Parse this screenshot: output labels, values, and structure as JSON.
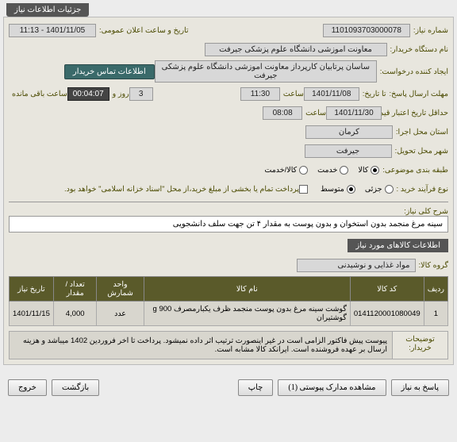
{
  "header_tab": "جزئیات اطلاعات نیاز",
  "labels": {
    "need_no": "شماره نیاز:",
    "buyer": "نام دستگاه خریدار:",
    "creator": "ایجاد کننده درخواست:",
    "deadline": "مهلت ارسال پاسخ:",
    "to_date": "تا تاریخ:",
    "credit_date": "حداقل تاریخ اعتبار قیمت؛ تا تاریخ:",
    "exec_province": "استان محل اجرا:",
    "delivery_city": "شهر محل تحویل:",
    "subject_class": "طبقه بندی موضوعی:",
    "buy_type": "نوع فرآیند خرید :",
    "announce": "تاریخ و ساعت اعلان عمومی:",
    "days_and": "روز و",
    "time_left": "ساعت باقی مانده",
    "hour": "ساعت",
    "contact_btn": "اطلاعات تماس خریدار",
    "main_desc": "شرح کلی نیاز:",
    "goods_info": "اطلاعات کالاهای مورد نیاز",
    "goods_group": "گروه کالا:",
    "buyer_notes": "توضیحات خریدار:"
  },
  "values": {
    "need_no": "1101093703000078",
    "buyer": "معاونت اموزشی دانشگاه علوم پزشکی جیرفت",
    "creator": "ساسان پرتابیان کارپرداز معاونت اموزشی دانشگاه علوم پزشکی جیرفت",
    "deadline_date": "1401/11/08",
    "deadline_time": "11:30",
    "days_left": "3",
    "countdown": "00:04:07",
    "credit_date": "1401/11/30",
    "credit_time": "08:08",
    "province": "کرمان",
    "city": "جیرفت",
    "announce": "1401/11/05 - 11:13",
    "main_desc": "سینه مرغ منجمد بدون استخوان و بدون پوست به مقدار ۴ تن جهت سلف دانشجویی",
    "goods_group": "مواد غذایی و نوشیدنی",
    "partial_pay_note": "پرداخت تمام یا بخشی از مبلغ خرید،از محل \"اسناد خزانه اسلامی\" خواهد بود.",
    "buyer_notes": "پیوست پیش فاکتور الزامی است در غیر اینصورت ترتیب اثر داده نمیشود. پرداخت تا اخر فروردین 1402 میباشد و هزینه ارسال بر عهده فروشنده است. ایرانکد کالا مشابه است."
  },
  "radios": {
    "subject": {
      "opt1": "کالا",
      "opt2": "خدمت",
      "opt3": "کالا/خدمت",
      "selected": "opt1"
    },
    "buy_type": {
      "opt1": "جزئی",
      "opt2": "متوسط",
      "selected": "opt2"
    }
  },
  "table": {
    "headers": {
      "row": "ردیف",
      "code": "کد کالا",
      "name": "نام کالا",
      "unit": "واحد شمارش",
      "qty": "تعداد / مقدار",
      "date": "تاریخ نیاز"
    },
    "rows": [
      {
        "row": "1",
        "code": "0141120001080049",
        "name": "گوشت سینه مرغ بدون پوست منجمد ظرف یکبارمصرف 900 g گوشتیران",
        "unit": "عدد",
        "qty": "4,000",
        "date": "1401/11/15"
      }
    ]
  },
  "buttons": {
    "back": "پاسخ به نیاز",
    "attachments": "مشاهده مدارک پیوستی (1)",
    "print": "چاپ",
    "return": "بازگشت",
    "exit": "خروج"
  }
}
